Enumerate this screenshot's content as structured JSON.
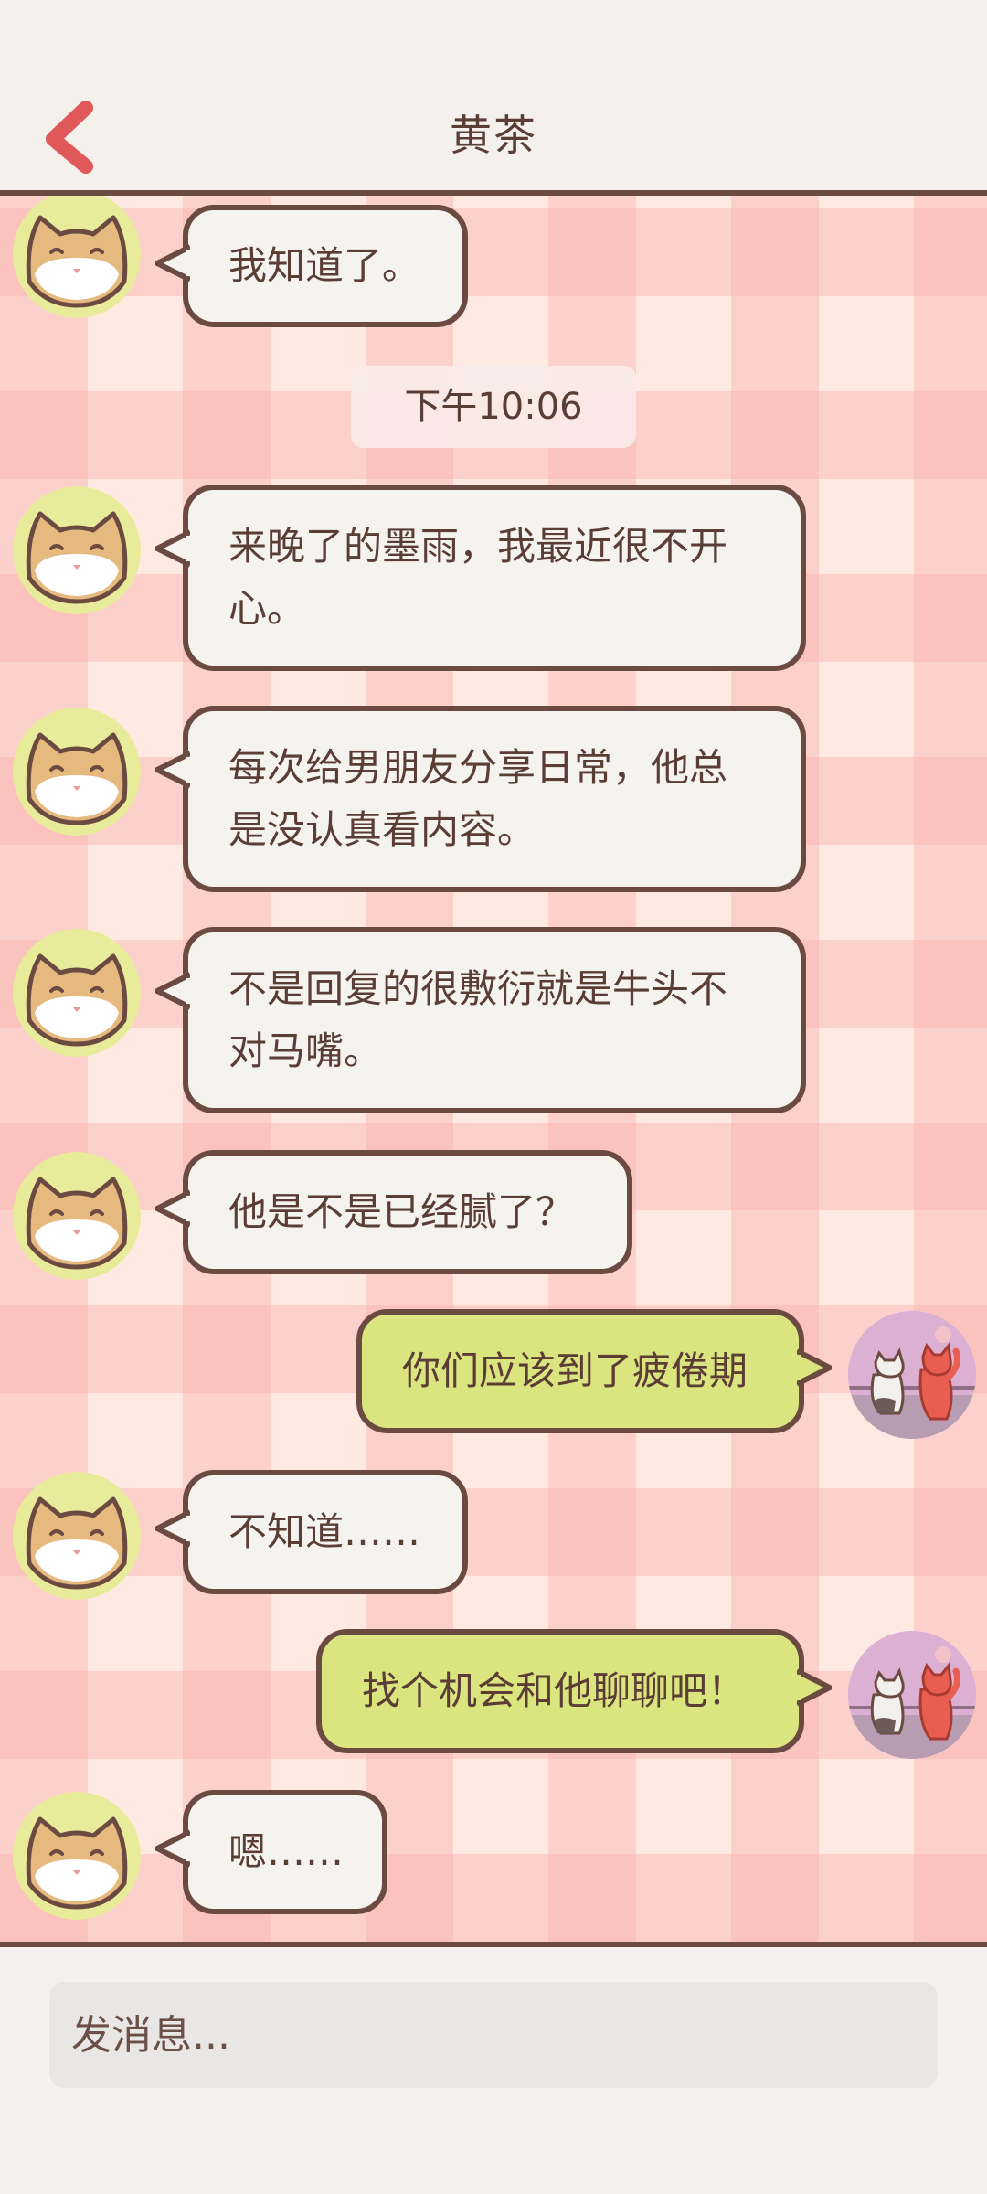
{
  "header": {
    "title": "黄茶"
  },
  "chat": {
    "timestamp": "下午10:06",
    "messages": [
      {
        "text": "我知道了。"
      },
      {
        "text": "来晚了的墨雨，我最近很不开\n心。"
      },
      {
        "text": "每次给男朋友分享日常，他总\n是没认真看内容。"
      },
      {
        "text": "不是回复的很敷衍就是牛头不\n对马嘴。"
      },
      {
        "text": "他是不是已经腻了？"
      },
      {
        "text": "你们应该到了疲倦期"
      },
      {
        "text": "不知道……"
      },
      {
        "text": "找个机会和他聊聊吧！"
      },
      {
        "text": "嗯……"
      }
    ]
  },
  "input": {
    "placeholder": "发消息..."
  },
  "colors": {
    "incoming_bubble": "#f5f3ee",
    "outgoing_bubble": "#dbe57f",
    "bubble_border": "#6b4a42",
    "back_arrow": "#e0585a",
    "status_dot": "#27c35a"
  }
}
